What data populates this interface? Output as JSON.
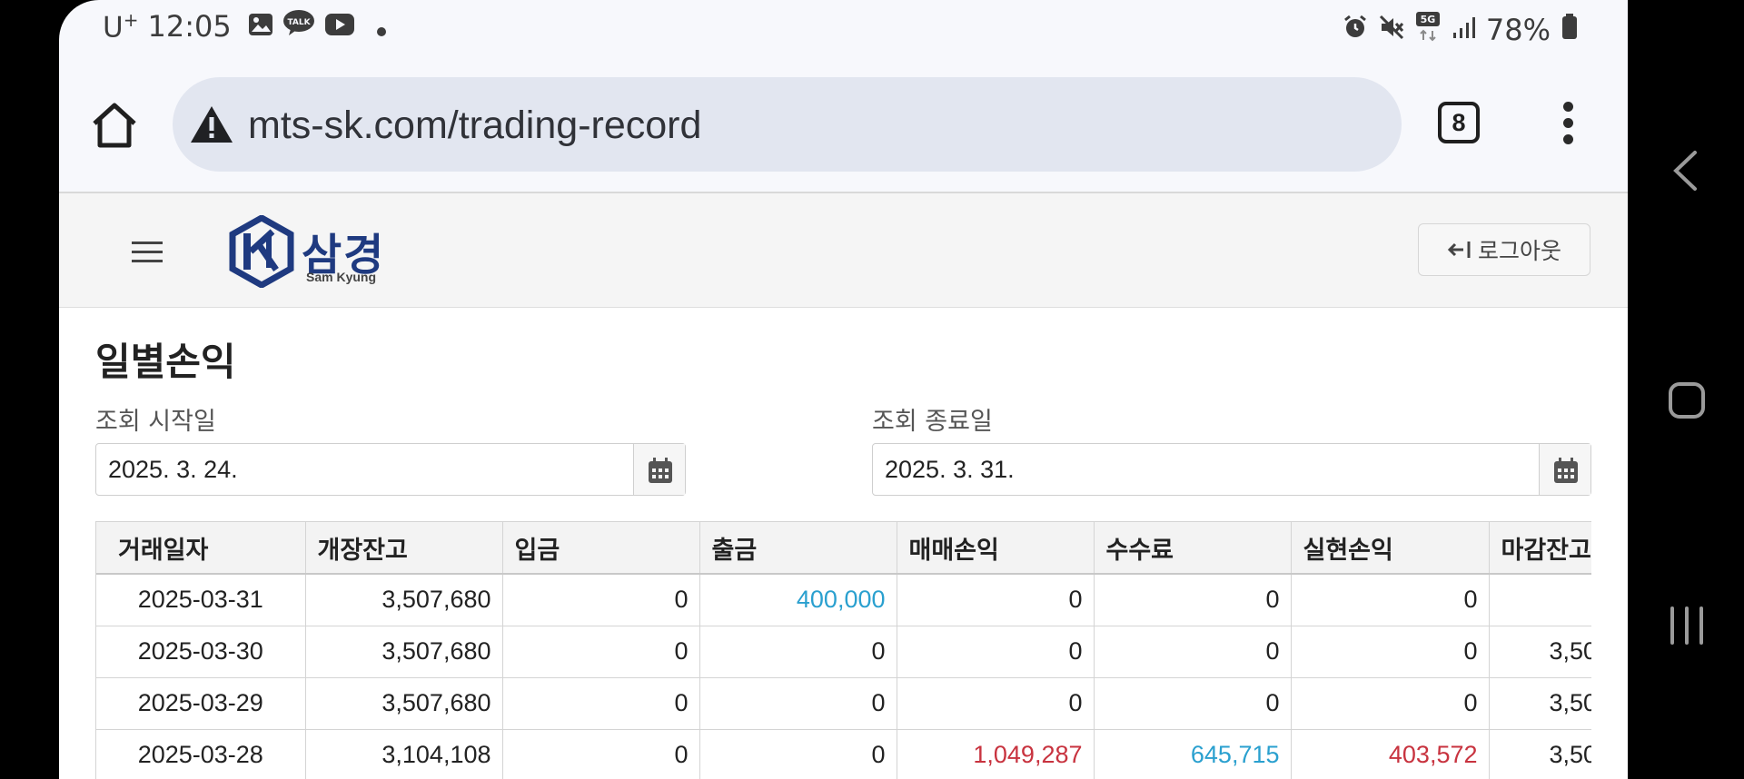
{
  "status_bar": {
    "carrier": "U",
    "carrier_sup": "+",
    "time": "12:05",
    "battery": "78%",
    "network": "5G"
  },
  "browser": {
    "url": "mts-sk.com/trading-record",
    "tab_count": "8"
  },
  "site": {
    "logo_ko": "삼경",
    "logo_en": "Sam Kyung",
    "logout_label": "로그아웃"
  },
  "page": {
    "title": "일별손익",
    "start_label": "조회 시작일",
    "start_value": "2025. 3. 24.",
    "end_label": "조회 종료일",
    "end_value": "2025. 3. 31."
  },
  "table": {
    "headers": [
      "거래일자",
      "개장잔고",
      "입금",
      "출금",
      "매매손익",
      "수수료",
      "실현손익",
      "마감잔고"
    ],
    "rows": [
      [
        "2025-03-31",
        "3,507,680",
        "0",
        "400,000",
        "0",
        "0",
        "0",
        ""
      ],
      [
        "2025-03-30",
        "3,507,680",
        "0",
        "0",
        "0",
        "0",
        "0",
        "3,50"
      ],
      [
        "2025-03-29",
        "3,507,680",
        "0",
        "0",
        "0",
        "0",
        "0",
        "3,50"
      ],
      [
        "2025-03-28",
        "3,104,108",
        "0",
        "0",
        "1,049,287",
        "645,715",
        "403,572",
        "3,50"
      ]
    ],
    "colors": {
      "withdraw_blue": "#2aa0cf",
      "fee_blue": "#2aa0cf",
      "profit_red": "#c8333f"
    }
  },
  "colors": {
    "brand": "#1f3a80",
    "address_bar": "#e2e6f0"
  }
}
